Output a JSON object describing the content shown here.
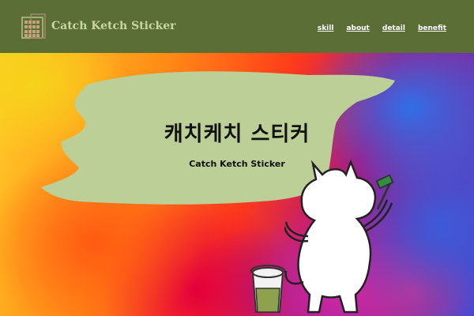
{
  "header": {
    "brand": "Catch Ketch Sticker",
    "logo_icon": "building-grid-icon",
    "nav": [
      "skill",
      "about",
      "detail",
      "benefit"
    ]
  },
  "hero": {
    "title": "캐치케치 스티커",
    "subtitle": "Catch Ketch Sticker",
    "background": "colorful-paint-texture",
    "illustration": "cat-painting-illustration"
  },
  "colors": {
    "header_bg": "#5a6e35",
    "brand_text": "#c9d6a3",
    "paint_blob": "#bccf96",
    "nav_text": "#ffffff"
  }
}
